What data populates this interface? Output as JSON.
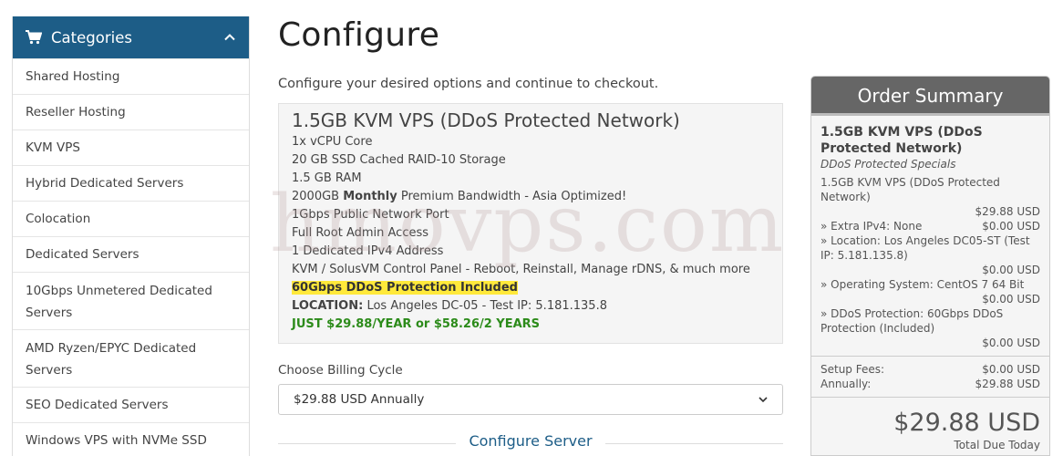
{
  "sidebar": {
    "header": "Categories",
    "items": [
      {
        "label": "Shared Hosting"
      },
      {
        "label": "Reseller Hosting"
      },
      {
        "label": "KVM VPS"
      },
      {
        "label": "Hybrid Dedicated Servers"
      },
      {
        "label": "Colocation"
      },
      {
        "label": "Dedicated Servers"
      },
      {
        "label": "10Gbps Unmetered Dedicated Servers"
      },
      {
        "label": "AMD Ryzen/EPYC Dedicated Servers"
      },
      {
        "label": "SEO Dedicated Servers"
      },
      {
        "label": "Windows VPS with NVMe SSD"
      }
    ]
  },
  "main": {
    "title": "Configure",
    "subtitle": "Configure your desired options and continue to checkout.",
    "product": {
      "name": "1.5GB KVM VPS (DDoS Protected Network)",
      "features": [
        "1x vCPU Core",
        "20 GB SSD Cached RAID-10 Storage",
        "1.5 GB RAM"
      ],
      "bandwidth_prefix": "2000GB ",
      "bandwidth_bold": "Monthly",
      "bandwidth_suffix": " Premium Bandwidth - Asia Optimized!",
      "features2": [
        "1Gbps Public Network Port",
        "Full Root Admin Access",
        "1 Dedicated IPv4 Address",
        "KVM / SolusVM Control Panel - Reboot, Reinstall, Manage rDNS, & much more"
      ],
      "ddos_highlight": "60Gbps DDoS Protection Included",
      "location_label": "LOCATION:",
      "location_value": " Los Angeles DC-05 - Test IP: 5.181.135.8",
      "promo": "JUST $29.88/YEAR or $58.26/2 YEARS"
    },
    "billing": {
      "label": "Choose Billing Cycle",
      "selected": "$29.88 USD Annually"
    },
    "configure_server": "Configure Server",
    "watermark": "hmovps.com"
  },
  "summary": {
    "header": "Order Summary",
    "product_name": "1.5GB KVM VPS (DDoS Protected Network)",
    "group": "DDoS Protected Specials",
    "product_line": "1.5GB KVM VPS (DDoS Protected Network)",
    "product_price": "$29.88 USD",
    "options": [
      {
        "label": "» Extra IPv4: None",
        "price": "$0.00 USD"
      },
      {
        "label": "» Location: Los Angeles DC05-ST (Test IP: 5.181.135.8)",
        "price": "$0.00 USD"
      },
      {
        "label": "» Operating System: CentOS 7 64 Bit",
        "price": "$0.00 USD"
      },
      {
        "label": "» DDoS Protection: 60Gbps DDoS Protection (Included)",
        "price": "$0.00 USD"
      }
    ],
    "setup_fees_label": "Setup Fees:",
    "setup_fees_value": "$0.00 USD",
    "annually_label": "Annually:",
    "annually_value": "$29.88 USD",
    "total": "$29.88 USD",
    "total_label": "Total Due Today"
  },
  "colors": {
    "sidebar_header": "#1d5d87",
    "summary_header": "#666666",
    "promo_green": "#2c8b1a",
    "highlight": "#ffe93b"
  }
}
